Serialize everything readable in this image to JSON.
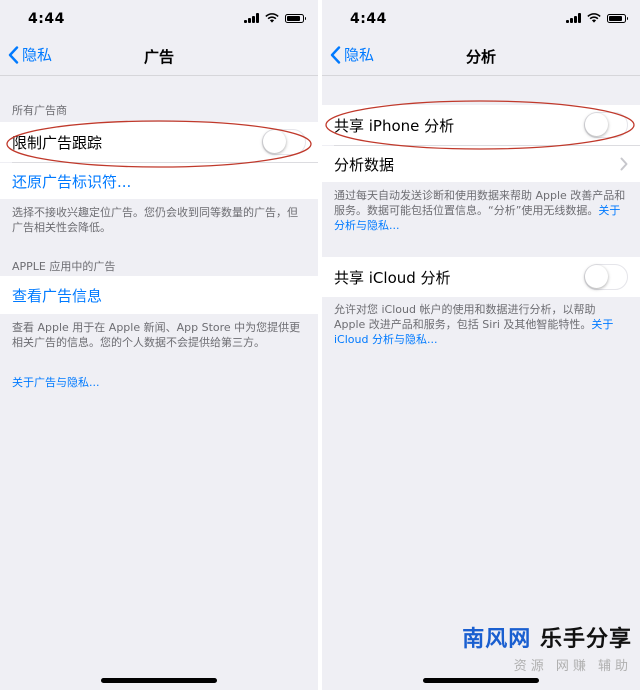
{
  "colors": {
    "ios_blue": "#007aff",
    "annotation_red": "#c0392b",
    "watermark_blue": "#1a5fd0",
    "watermark_black": "#111111"
  },
  "left": {
    "status": {
      "time": "4:44"
    },
    "nav": {
      "back_label": "隐私",
      "title": "广告"
    },
    "section1_header": "所有广告商",
    "limit_tracking": {
      "label": "限制广告跟踪",
      "toggle_on": false
    },
    "reset_id_label": "还原广告标识符...",
    "section1_footer": "选择不接收兴趣定位广告。您仍会收到同等数量的广告，但广告相关性会降低。",
    "section2_header": "APPLE 应用中的广告",
    "view_ad_info_label": "查看广告信息",
    "section2_footer": "查看 Apple 用于在 Apple 新闻、App Store 中为您提供更相关广告的信息。您的个人数据不会提供给第三方。",
    "about_link": "关于广告与隐私..."
  },
  "right": {
    "status": {
      "time": "4:44"
    },
    "nav": {
      "back_label": "隐私",
      "title": "分析"
    },
    "share_iphone": {
      "label": "共享 iPhone 分析",
      "toggle_on": false
    },
    "analytics_data_label": "分析数据",
    "footer1_text": "通过每天自动发送诊断和使用数据来帮助 Apple 改善产品和服务。数据可能包括位置信息。“分析”使用无线数据。",
    "footer1_link": "关于分析与隐私...",
    "share_icloud": {
      "label": "共享 iCloud 分析",
      "toggle_on": false
    },
    "footer2_text": "允许对您 iCloud 帐户的使用和数据进行分析，以帮助 Apple 改进产品和服务，包括 Siri 及其他智能特性。",
    "footer2_link": "关于 iCloud 分析与隐私..."
  },
  "watermark": {
    "part1": "南风网",
    "part2": "乐手分享",
    "sub": "资源 网赚 辅助"
  }
}
